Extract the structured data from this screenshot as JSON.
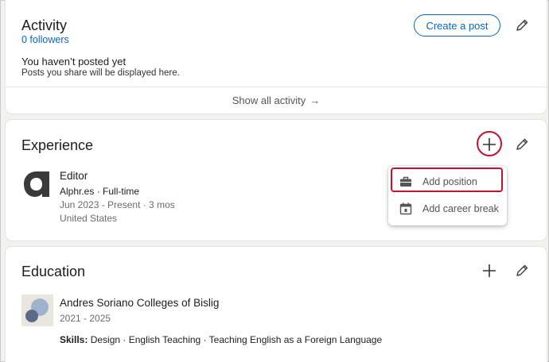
{
  "activity": {
    "title": "Activity",
    "followers": "0 followers",
    "create_post_label": "Create a post",
    "empty_title": "You haven’t posted yet",
    "empty_subtitle": "Posts you share will be displayed here.",
    "show_all_label": "Show all activity",
    "show_all_arrow": "→"
  },
  "experience": {
    "title": "Experience",
    "item": {
      "role": "Editor",
      "company": "Alphr.es · Full-time",
      "dates": "Jun 2023 - Present · 3 mos",
      "location": "United States",
      "logo_letter": "a"
    },
    "dropdown": {
      "items": [
        {
          "label": "Add position",
          "icon": "briefcase-icon"
        },
        {
          "label": "Add career break",
          "icon": "calendar-icon"
        }
      ]
    }
  },
  "education": {
    "title": "Education",
    "item": {
      "school": "Andres Soriano Colleges of Bislig",
      "years": "2021 - 2025",
      "skills_label": "Skills:",
      "skills": " Design · English Teaching · Teaching English as a Foreign Language"
    }
  },
  "colors": {
    "accent": "#0a66c2",
    "highlight": "#c8102e",
    "background": "#f3f2ef"
  }
}
